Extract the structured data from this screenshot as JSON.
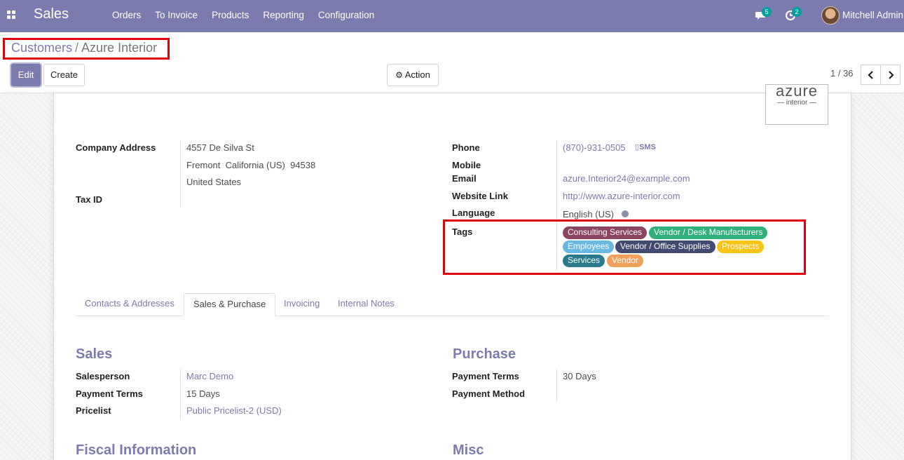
{
  "navbar": {
    "app_name": "Sales",
    "menu": [
      "Orders",
      "To Invoice",
      "Products",
      "Reporting",
      "Configuration"
    ],
    "messages_count": "5",
    "activities_count": "2",
    "user_name": "Mitchell Admin",
    "color": "#7c7bad"
  },
  "breadcrumb": {
    "parent": "Customers",
    "separator": "/",
    "current": "Azure Interior"
  },
  "buttons": {
    "edit": "Edit",
    "create": "Create",
    "action": "Action"
  },
  "pager": {
    "value": "1 / 36"
  },
  "logo": {
    "line1": "azure",
    "line2": "— interior —"
  },
  "left_fields": {
    "company_address_label": "Company Address",
    "street": "4557 De Silva St",
    "city_line": "Fremont  California (US)  94538",
    "country": "United States",
    "tax_id_label": "Tax ID"
  },
  "right_fields": {
    "phone_label": "Phone",
    "phone": "(870)-931-0505",
    "sms_label": "SMS",
    "mobile_label": "Mobile",
    "email_label": "Email",
    "email": "azure.Interior24@example.com",
    "website_label": "Website Link",
    "website": "http://www.azure-interior.com",
    "language_label": "Language",
    "language": "English (US)",
    "tags_label": "Tags"
  },
  "tags": [
    {
      "label": "Consulting Services",
      "color": "#8b4560"
    },
    {
      "label": "Vendor / Desk Manufacturers",
      "color": "#30b07a"
    },
    {
      "label": "Employees",
      "color": "#6ab8e0"
    },
    {
      "label": "Vendor / Office Supplies",
      "color": "#424a72"
    },
    {
      "label": "Prospects",
      "color": "#f5c518"
    },
    {
      "label": "Services",
      "color": "#2a7a8c"
    },
    {
      "label": "Vendor",
      "color": "#f0a05a"
    }
  ],
  "tabs": [
    "Contacts & Addresses",
    "Sales & Purchase",
    "Invoicing",
    "Internal Notes"
  ],
  "active_tab": "Sales & Purchase",
  "sales": {
    "title": "Sales",
    "salesperson_label": "Salesperson",
    "salesperson": "Marc Demo",
    "payment_terms_label": "Payment Terms",
    "payment_terms": "15 Days",
    "pricelist_label": "Pricelist",
    "pricelist": "Public Pricelist-2 (USD)"
  },
  "purchase": {
    "title": "Purchase",
    "payment_terms_label": "Payment Terms",
    "payment_terms": "30 Days",
    "payment_method_label": "Payment Method"
  },
  "fiscal": {
    "title": "Fiscal Information"
  },
  "misc": {
    "title": "Misc"
  },
  "highlight_color": "#e0000a"
}
